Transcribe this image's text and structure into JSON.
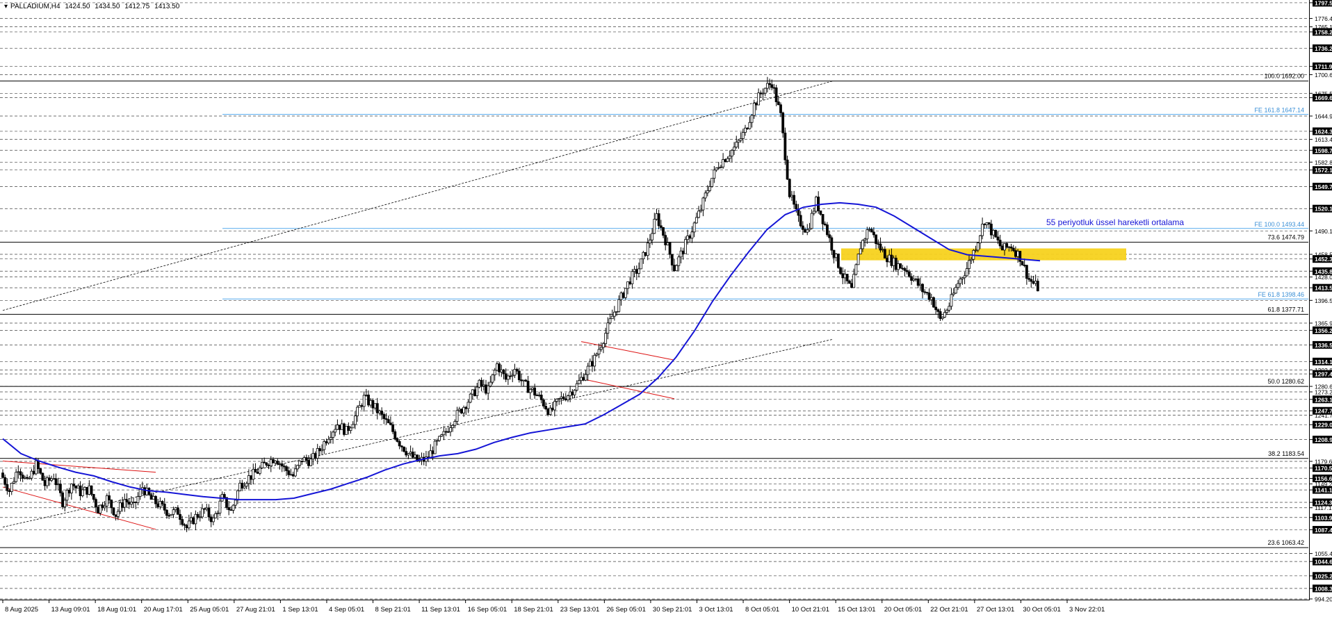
{
  "header": {
    "symbol": "PALLADIUM,H4",
    "open": "1424.50",
    "high": "1434.50",
    "low": "1412.75",
    "close": "1413.50"
  },
  "annotation": "55 periyotluk üssel hareketli ortalama",
  "colors": {
    "grid": "#000000",
    "candle": "#000000",
    "ema": "#1515d6",
    "fe_line": "#55aaee",
    "fibo_line": "#000000",
    "zone": "#f7d21e",
    "channel": "#dd1111",
    "annotation": "#1515d6"
  },
  "chart_data": {
    "type": "candlestick",
    "symbol": "PALLADIUM",
    "timeframe": "H4",
    "ylim": [
      994.2,
      1797.5
    ],
    "price_levels": [
      "1797.55",
      "1776.40",
      "1765.10",
      "1758.25",
      "1736.25",
      "1711.90",
      "1700.60",
      "1675.50",
      "1669.60",
      "1644.90",
      "1624.35",
      "1613.40",
      "1598.75",
      "1582.80",
      "1572.15",
      "1549.75",
      "1520.15",
      "1490.10",
      "1458.55",
      "1452.30",
      "1435.85",
      "1428.00",
      "1413.50",
      "1396.50",
      "1365.90",
      "1356.20",
      "1336.50",
      "1314.10",
      "1302.80",
      "1297.40",
      "1280.62",
      "1273.20",
      "1263.10",
      "1247.70",
      "1241.70",
      "1229.00",
      "1208.95",
      "1179.60",
      "1170.50",
      "1156.65",
      "1149.20",
      "1141.10",
      "1124.35",
      "1117.10",
      "1103.95",
      "1087.40",
      "1055.40",
      "1044.65",
      "1025.25",
      "1008.35",
      "994.20"
    ],
    "highlighted_levels": [
      "1797.55",
      "1758.25",
      "1736.25",
      "1711.90",
      "1669.60",
      "1624.35",
      "1598.75",
      "1572.15",
      "1549.75",
      "1520.15",
      "1452.30",
      "1435.85",
      "1413.50",
      "1356.20",
      "1336.50",
      "1314.10",
      "1297.40",
      "1263.10",
      "1247.70",
      "1229.00",
      "1208.95",
      "1170.50",
      "1156.65",
      "1141.10",
      "1124.35",
      "1103.95",
      "1087.40",
      "1044.65",
      "1025.25",
      "1008.35"
    ],
    "x_labels": [
      "8 Aug 2025",
      "13 Aug 09:01",
      "18 Aug 01:01",
      "20 Aug 17:01",
      "25 Aug 05:01",
      "27 Aug 21:01",
      "1 Sep 13:01",
      "4 Sep 05:01",
      "8 Sep 21:01",
      "11 Sep 13:01",
      "16 Sep 05:01",
      "18 Sep 21:01",
      "23 Sep 13:01",
      "26 Sep 05:01",
      "30 Sep 21:01",
      "3 Oct 13:01",
      "8 Oct 05:01",
      "10 Oct 21:01",
      "15 Oct 13:01",
      "20 Oct 05:01",
      "22 Oct 21:01",
      "27 Oct 13:01",
      "30 Oct 05:01",
      "3 Nov 22:01"
    ],
    "fibo_levels": [
      {
        "label": "100.0 1692.00",
        "price": 1692.0
      },
      {
        "label": "73.6 1474.79",
        "price": 1474.79
      },
      {
        "label": "61.8 1377.71",
        "price": 1377.71
      },
      {
        "label": "50.0 1280.62",
        "price": 1280.62
      },
      {
        "label": "38.2 1183.54",
        "price": 1183.54
      },
      {
        "label": "23.6 1063.42",
        "price": 1063.42
      }
    ],
    "fe_levels": [
      {
        "label": "FE 161.8 1647.14",
        "price": 1647.14
      },
      {
        "label": "FE 100.0 1493.44",
        "price": 1493.44
      },
      {
        "label": "FE 61.8 1398.46",
        "price": 1398.46
      }
    ],
    "resistance_zone": [
      1450.5,
      1466.5
    ],
    "ema_period": 55,
    "ohlc_path": [
      1164,
      1140,
      1172,
      1150,
      1175,
      1148,
      1160,
      1125,
      1150,
      1138,
      1142,
      1115,
      1130,
      1108,
      1128,
      1118,
      1145,
      1128,
      1120,
      1110,
      1112,
      1090,
      1105,
      1114,
      1100,
      1130,
      1112,
      1148,
      1158,
      1166,
      1178,
      1185,
      1170,
      1160,
      1182,
      1180,
      1195,
      1215,
      1230,
      1220,
      1240,
      1265,
      1255,
      1240,
      1225,
      1205,
      1190,
      1180,
      1182,
      1200,
      1215,
      1235,
      1250,
      1265,
      1283,
      1275,
      1310,
      1290,
      1305,
      1283,
      1275,
      1262,
      1245,
      1262,
      1270,
      1282,
      1300,
      1318,
      1345,
      1375,
      1400,
      1425,
      1440,
      1470,
      1510,
      1478,
      1440,
      1465,
      1492,
      1520,
      1555,
      1580,
      1592,
      1605,
      1625,
      1660,
      1680,
      1690,
      1645,
      1540,
      1505,
      1490,
      1530,
      1498,
      1460,
      1430,
      1410,
      1470,
      1495,
      1470,
      1455,
      1445,
      1440,
      1425,
      1410,
      1400,
      1370,
      1390,
      1420,
      1440,
      1470,
      1505,
      1485,
      1465,
      1470,
      1455,
      1425,
      1413.5
    ],
    "ema_values": [
      1210,
      1190,
      1180,
      1172,
      1165,
      1160,
      1152,
      1145,
      1140,
      1138,
      1135,
      1132,
      1130,
      1128,
      1128,
      1128,
      1130,
      1136,
      1142,
      1150,
      1158,
      1168,
      1176,
      1182,
      1187,
      1190,
      1196,
      1205,
      1212,
      1218,
      1222,
      1226,
      1230,
      1242,
      1256,
      1270,
      1292,
      1320,
      1355,
      1395,
      1430,
      1462,
      1492,
      1512,
      1522,
      1526,
      1528,
      1526,
      1522,
      1510,
      1495,
      1480,
      1465,
      1458,
      1456,
      1454,
      1452,
      1450
    ],
    "channels": [
      {
        "upper": [
          [
            1127,
            1180
          ],
          [
            1182,
            1165
          ]
        ],
        "lower": [
          [
            1127,
            1145
          ],
          [
            1182,
            1088
          ]
        ]
      },
      {
        "upper": [
          [
            1360,
            1341
          ],
          [
            1398,
            1316
          ]
        ],
        "lower": [
          [
            1360,
            1291
          ],
          [
            1398,
            1264
          ]
        ]
      }
    ],
    "dotted_lines": [
      {
        "from": [
          1088,
          1383
        ],
        "to": [
          1665,
          1692
        ]
      },
      {
        "from": [
          1310,
          1091
        ],
        "to": [
          1355,
          1344
        ]
      }
    ]
  }
}
